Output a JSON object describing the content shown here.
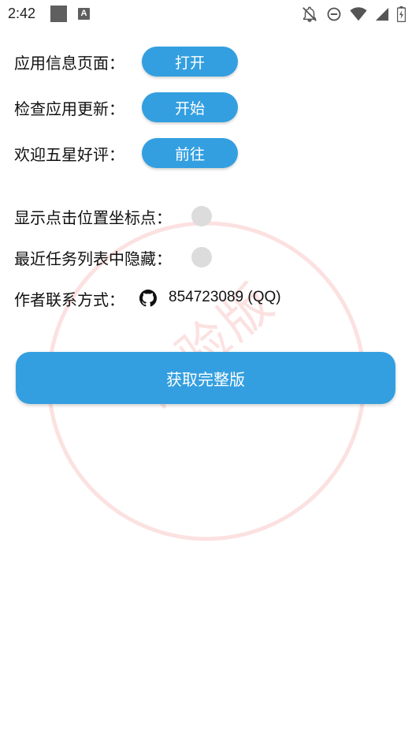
{
  "status_bar": {
    "time": "2:42",
    "icons": [
      "gallery-square-icon",
      "a-notification-icon",
      "notifications-off-icon",
      "do-not-disturb-icon",
      "wifi-icon",
      "cellular-icon",
      "battery-icon"
    ],
    "notification_letter": "A"
  },
  "actions": {
    "app_info_label": "应用信息页面：",
    "app_info_button": "打开",
    "update_label": "检查应用更新：",
    "update_button": "开始",
    "review_label": "欢迎五星好评：",
    "review_button": "前往"
  },
  "settings": {
    "show_tap_label": "显示点击位置坐标点：",
    "show_tap_enabled": false,
    "hide_recents_label": "最近任务列表中隐藏：",
    "hide_recents_enabled": false
  },
  "contact": {
    "label": "作者联系方式：",
    "qq": "854723089 (QQ)"
  },
  "get_full_button": "获取完整版",
  "watermark_text": "体验版",
  "colors": {
    "accent": "#339fe0",
    "toggle_off": "#dcdcdc",
    "watermark": "#f07878"
  }
}
